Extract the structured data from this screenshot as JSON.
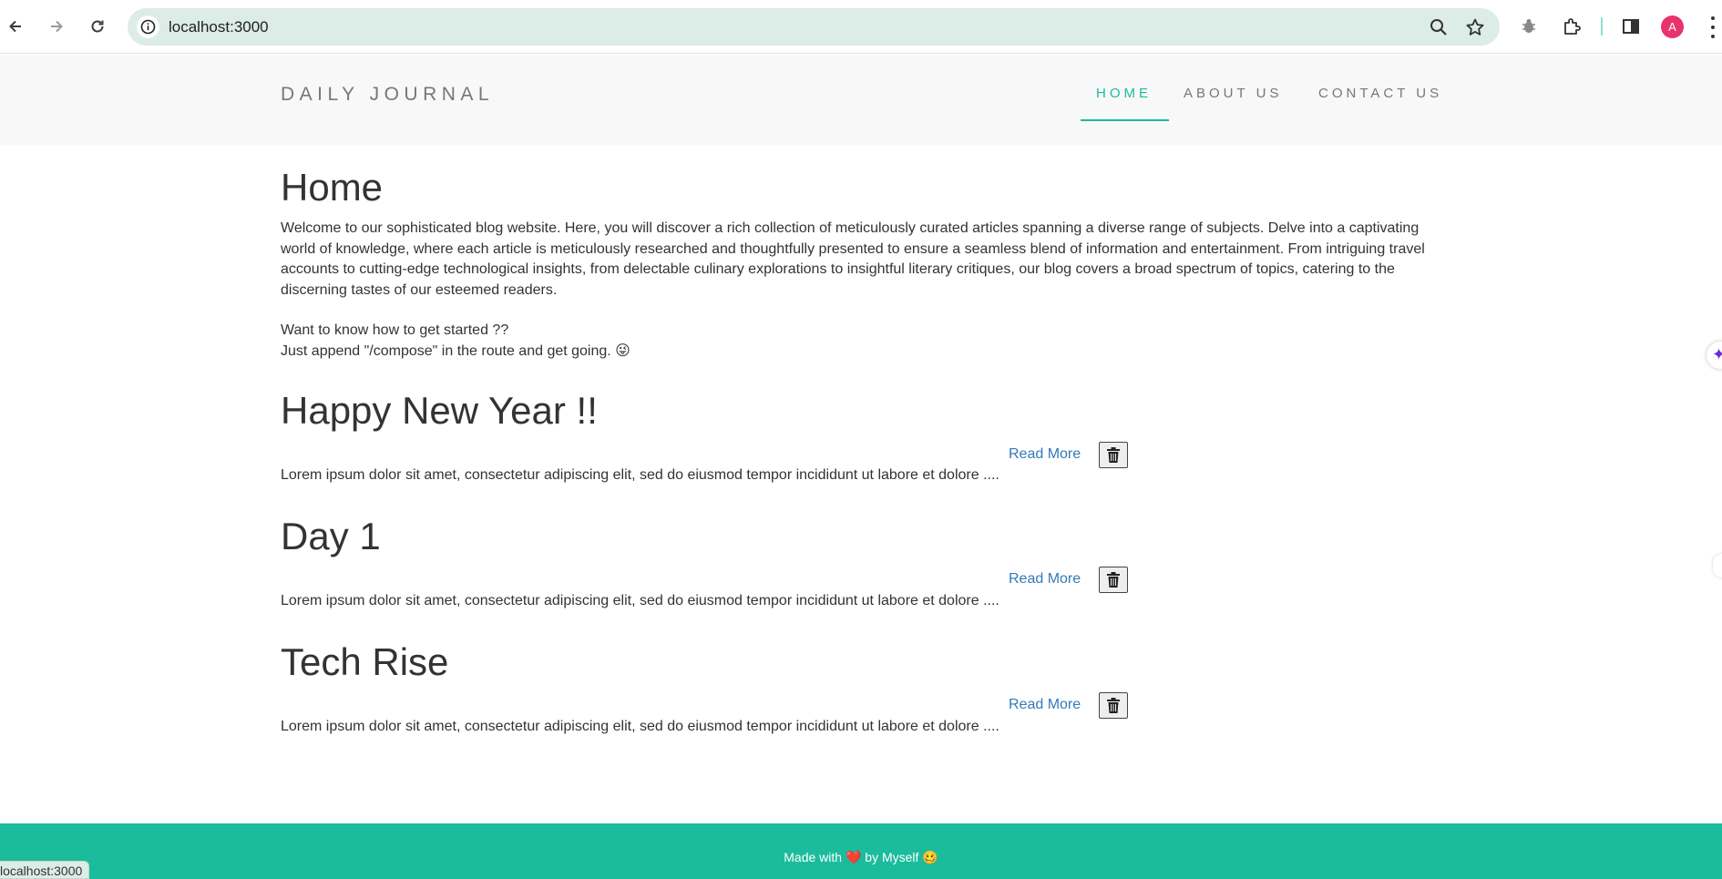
{
  "browser": {
    "url": "localhost:3000",
    "profile_initial": "A",
    "status_url": "localhost:3000"
  },
  "header": {
    "brand": "DAILY JOURNAL",
    "nav": [
      {
        "label": "HOME",
        "active": true
      },
      {
        "label": "ABOUT US",
        "active": false
      },
      {
        "label": "CONTACT US",
        "active": false
      }
    ]
  },
  "main": {
    "title": "Home",
    "intro": "Welcome to our sophisticated blog website. Here, you will discover a rich collection of meticulously curated articles spanning a diverse range of subjects. Delve into a captivating world of knowledge, where each article is meticulously researched and thoughtfully presented to ensure a seamless blend of information and entertainment. From intriguing travel accounts to cutting-edge technological insights, from delectable culinary explorations to insightful literary critiques, our blog covers a broad spectrum of topics, catering to the discerning tastes of our esteemed readers.",
    "started_line1": "Want to know how to get started ??",
    "started_line2": "Just append \"/compose\" in the route and get going. 😜",
    "posts": [
      {
        "title": "Happy New Year !!",
        "excerpt": "Lorem ipsum dolor sit amet, consectetur adipiscing elit, sed do eiusmod tempor incididunt ut labore et dolore ....",
        "read_more": "Read More"
      },
      {
        "title": "Day 1",
        "excerpt": "Lorem ipsum dolor sit amet, consectetur adipiscing elit, sed do eiusmod tempor incididunt ut labore et dolore ....",
        "read_more": "Read More"
      },
      {
        "title": "Tech Rise",
        "excerpt": "Lorem ipsum dolor sit amet, consectetur adipiscing elit, sed do eiusmod tempor incididunt ut labore et dolore ....",
        "read_more": "Read More"
      }
    ]
  },
  "footer": {
    "made_with": "Made with",
    "heart": "❤️",
    "by": "by Myself",
    "emoji": "🥴"
  },
  "colors": {
    "accent": "#1abc9c",
    "link": "#337ab7",
    "header_bg": "#f8f8f8"
  }
}
